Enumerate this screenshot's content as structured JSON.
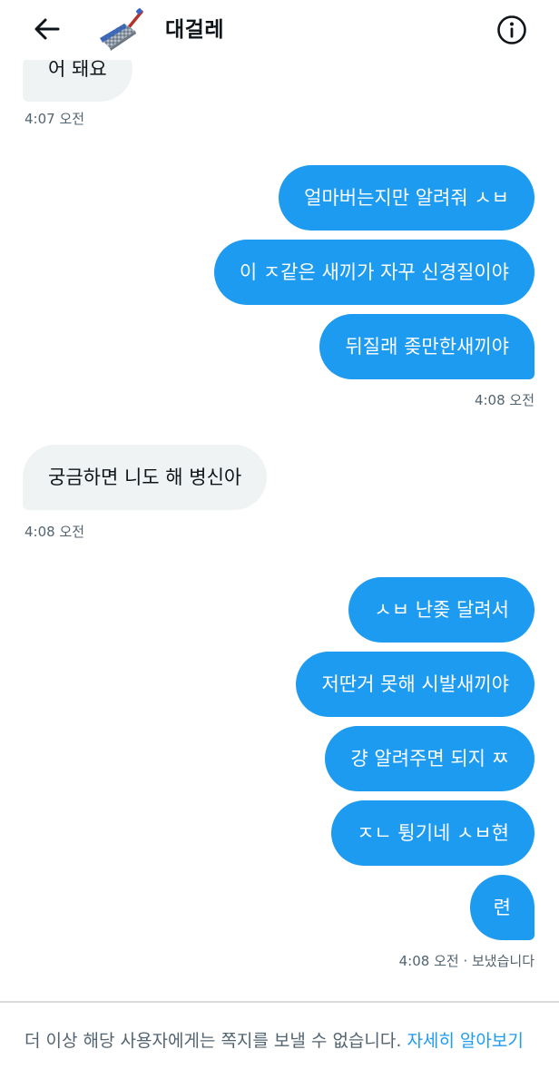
{
  "header": {
    "title": "대걸레",
    "back_icon": "arrow-left-icon",
    "info_icon": "info-circle-icon"
  },
  "colors": {
    "accent": "#1d9bf0",
    "incoming_bubble": "#eff3f4",
    "text": "#0f1419",
    "muted": "#536471"
  },
  "messages": [
    {
      "side": "in",
      "text": "어 돼요"
    },
    {
      "side": "ts",
      "text": "4:07 오전"
    },
    {
      "side": "out",
      "text": "얼마버는지만 알려줘 ㅅㅂ"
    },
    {
      "side": "out",
      "text": "이 ㅈ같은 새끼가 자꾸 신경질이야"
    },
    {
      "side": "out",
      "text": "뒤질래 좆만한새끼야"
    },
    {
      "side": "ts",
      "text": "4:08 오전"
    },
    {
      "side": "in",
      "text": "궁금하면 니도 해 병신아"
    },
    {
      "side": "ts",
      "text": "4:08 오전"
    },
    {
      "side": "out",
      "text": "ㅅㅂ 난좆 달려서"
    },
    {
      "side": "out",
      "text": "저딴거 못해 시발새끼야"
    },
    {
      "side": "out",
      "text": "걍 알려주면 되지 ㅉ"
    },
    {
      "side": "out",
      "text": "ㅈㄴ 튕기네 ㅅㅂ현"
    },
    {
      "side": "out",
      "text": "련"
    },
    {
      "side": "ts",
      "text": "4:08 오전 · 보냈습니다"
    }
  ],
  "notice": {
    "text": "더 이상 해당 사용자에게는 쪽지를 보낼 수 없습니다. ",
    "link": "자세히 알아보기"
  }
}
